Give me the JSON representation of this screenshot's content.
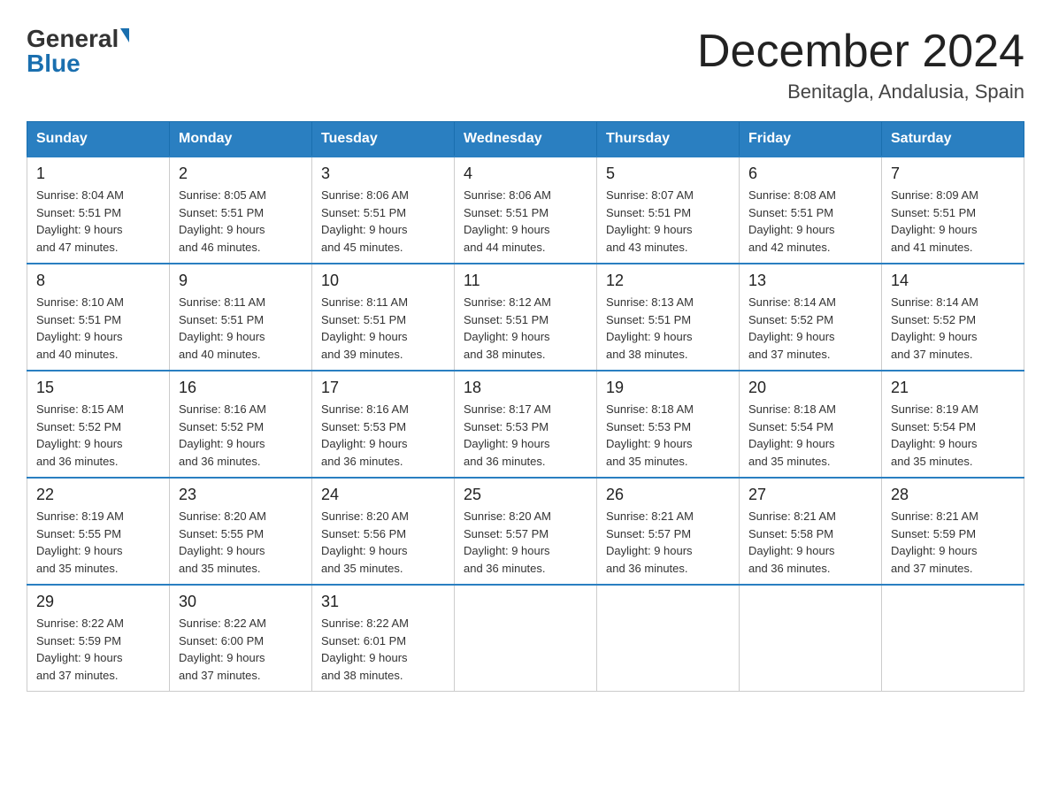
{
  "header": {
    "logo_general": "General",
    "logo_blue": "Blue",
    "month_title": "December 2024",
    "location": "Benitagla, Andalusia, Spain"
  },
  "days_of_week": [
    "Sunday",
    "Monday",
    "Tuesday",
    "Wednesday",
    "Thursday",
    "Friday",
    "Saturday"
  ],
  "weeks": [
    [
      {
        "day": "1",
        "sunrise": "8:04 AM",
        "sunset": "5:51 PM",
        "daylight": "9 hours and 47 minutes."
      },
      {
        "day": "2",
        "sunrise": "8:05 AM",
        "sunset": "5:51 PM",
        "daylight": "9 hours and 46 minutes."
      },
      {
        "day": "3",
        "sunrise": "8:06 AM",
        "sunset": "5:51 PM",
        "daylight": "9 hours and 45 minutes."
      },
      {
        "day": "4",
        "sunrise": "8:06 AM",
        "sunset": "5:51 PM",
        "daylight": "9 hours and 44 minutes."
      },
      {
        "day": "5",
        "sunrise": "8:07 AM",
        "sunset": "5:51 PM",
        "daylight": "9 hours and 43 minutes."
      },
      {
        "day": "6",
        "sunrise": "8:08 AM",
        "sunset": "5:51 PM",
        "daylight": "9 hours and 42 minutes."
      },
      {
        "day": "7",
        "sunrise": "8:09 AM",
        "sunset": "5:51 PM",
        "daylight": "9 hours and 41 minutes."
      }
    ],
    [
      {
        "day": "8",
        "sunrise": "8:10 AM",
        "sunset": "5:51 PM",
        "daylight": "9 hours and 40 minutes."
      },
      {
        "day": "9",
        "sunrise": "8:11 AM",
        "sunset": "5:51 PM",
        "daylight": "9 hours and 40 minutes."
      },
      {
        "day": "10",
        "sunrise": "8:11 AM",
        "sunset": "5:51 PM",
        "daylight": "9 hours and 39 minutes."
      },
      {
        "day": "11",
        "sunrise": "8:12 AM",
        "sunset": "5:51 PM",
        "daylight": "9 hours and 38 minutes."
      },
      {
        "day": "12",
        "sunrise": "8:13 AM",
        "sunset": "5:51 PM",
        "daylight": "9 hours and 38 minutes."
      },
      {
        "day": "13",
        "sunrise": "8:14 AM",
        "sunset": "5:52 PM",
        "daylight": "9 hours and 37 minutes."
      },
      {
        "day": "14",
        "sunrise": "8:14 AM",
        "sunset": "5:52 PM",
        "daylight": "9 hours and 37 minutes."
      }
    ],
    [
      {
        "day": "15",
        "sunrise": "8:15 AM",
        "sunset": "5:52 PM",
        "daylight": "9 hours and 36 minutes."
      },
      {
        "day": "16",
        "sunrise": "8:16 AM",
        "sunset": "5:52 PM",
        "daylight": "9 hours and 36 minutes."
      },
      {
        "day": "17",
        "sunrise": "8:16 AM",
        "sunset": "5:53 PM",
        "daylight": "9 hours and 36 minutes."
      },
      {
        "day": "18",
        "sunrise": "8:17 AM",
        "sunset": "5:53 PM",
        "daylight": "9 hours and 36 minutes."
      },
      {
        "day": "19",
        "sunrise": "8:18 AM",
        "sunset": "5:53 PM",
        "daylight": "9 hours and 35 minutes."
      },
      {
        "day": "20",
        "sunrise": "8:18 AM",
        "sunset": "5:54 PM",
        "daylight": "9 hours and 35 minutes."
      },
      {
        "day": "21",
        "sunrise": "8:19 AM",
        "sunset": "5:54 PM",
        "daylight": "9 hours and 35 minutes."
      }
    ],
    [
      {
        "day": "22",
        "sunrise": "8:19 AM",
        "sunset": "5:55 PM",
        "daylight": "9 hours and 35 minutes."
      },
      {
        "day": "23",
        "sunrise": "8:20 AM",
        "sunset": "5:55 PM",
        "daylight": "9 hours and 35 minutes."
      },
      {
        "day": "24",
        "sunrise": "8:20 AM",
        "sunset": "5:56 PM",
        "daylight": "9 hours and 35 minutes."
      },
      {
        "day": "25",
        "sunrise": "8:20 AM",
        "sunset": "5:57 PM",
        "daylight": "9 hours and 36 minutes."
      },
      {
        "day": "26",
        "sunrise": "8:21 AM",
        "sunset": "5:57 PM",
        "daylight": "9 hours and 36 minutes."
      },
      {
        "day": "27",
        "sunrise": "8:21 AM",
        "sunset": "5:58 PM",
        "daylight": "9 hours and 36 minutes."
      },
      {
        "day": "28",
        "sunrise": "8:21 AM",
        "sunset": "5:59 PM",
        "daylight": "9 hours and 37 minutes."
      }
    ],
    [
      {
        "day": "29",
        "sunrise": "8:22 AM",
        "sunset": "5:59 PM",
        "daylight": "9 hours and 37 minutes."
      },
      {
        "day": "30",
        "sunrise": "8:22 AM",
        "sunset": "6:00 PM",
        "daylight": "9 hours and 37 minutes."
      },
      {
        "day": "31",
        "sunrise": "8:22 AM",
        "sunset": "6:01 PM",
        "daylight": "9 hours and 38 minutes."
      },
      null,
      null,
      null,
      null
    ]
  ],
  "labels": {
    "sunrise": "Sunrise:",
    "sunset": "Sunset:",
    "daylight": "Daylight:"
  }
}
